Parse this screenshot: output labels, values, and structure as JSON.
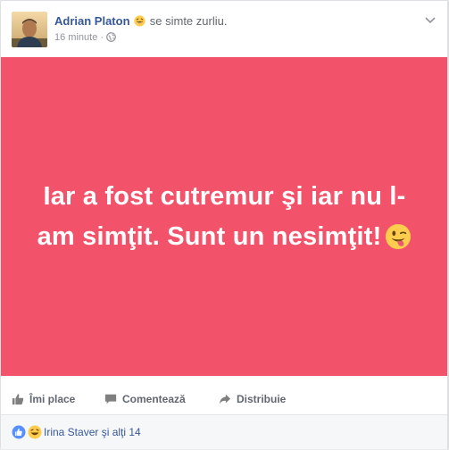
{
  "post": {
    "author": "Adrian Platon",
    "feeling": "se simte zurliu.",
    "time": "16 minute",
    "separator": "·",
    "privacy_icon": "globe-icon",
    "menu_icon": "chevron-down-icon",
    "banner": {
      "text": "Iar a fost cutremur şi iar nu l-am simţit. Sunt un nesimţit!",
      "background": "#f2526a",
      "text_color": "#ffffff",
      "emoji": "winking-tongue-emoji"
    }
  },
  "actions": {
    "like_label": "Îmi place",
    "comment_label": "Comentează",
    "share_label": "Distribuie"
  },
  "reactions": {
    "icons": [
      "like-reaction-icon",
      "haha-reaction-icon"
    ],
    "summary": "Irina Staver şi alţi 14"
  },
  "colors": {
    "link": "#365899",
    "muted": "#90949c",
    "action": "#616770",
    "like_blue": "#5890ff"
  }
}
